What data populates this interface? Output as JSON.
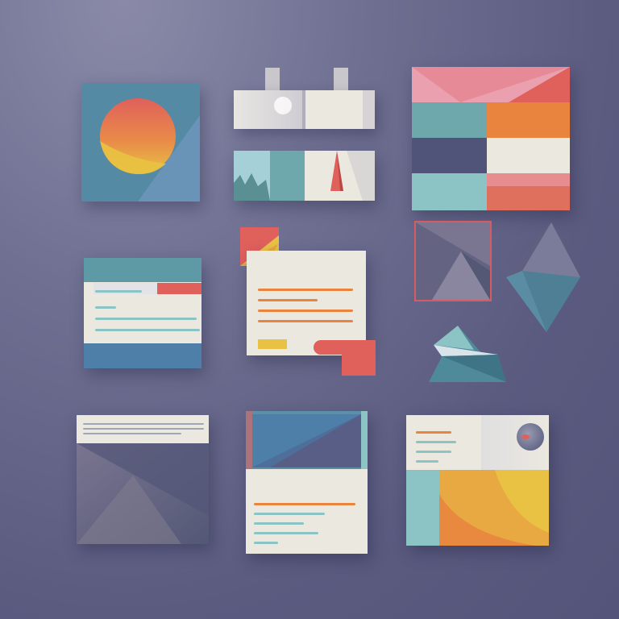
{
  "colors": {
    "background": "#62628a",
    "teal": "#5e9aa5",
    "steel_blue": "#4d7fa8",
    "coral": "#e0605c",
    "orange": "#e8843e",
    "yellow": "#e9c243",
    "pink": "#eba0b0",
    "cream": "#ebe8e0",
    "slate": "#4f5478",
    "light_teal": "#8cc3c5",
    "grey_violet": "#76718c"
  },
  "cards": [
    {
      "name": "sun-card",
      "icon": "sun-icon"
    },
    {
      "name": "toolbar-card",
      "icon": "tab-icon"
    },
    {
      "name": "landscape-card",
      "icon": "mountain-icon"
    },
    {
      "name": "color-blocks-card",
      "icon": "envelope-icon"
    },
    {
      "name": "form-card",
      "icon": "text-lines-icon"
    },
    {
      "name": "note-card",
      "icon": "document-icon"
    },
    {
      "name": "framed-shape-card",
      "icon": "triangle-icon"
    },
    {
      "name": "diamond-shape",
      "icon": "diamond-icon"
    },
    {
      "name": "paper-plane-shape",
      "icon": "paper-plane-icon"
    },
    {
      "name": "header-gradient-card",
      "icon": "text-lines-icon"
    },
    {
      "name": "hero-document-card",
      "icon": "image-icon"
    },
    {
      "name": "media-card",
      "icon": "circle-icon"
    }
  ]
}
